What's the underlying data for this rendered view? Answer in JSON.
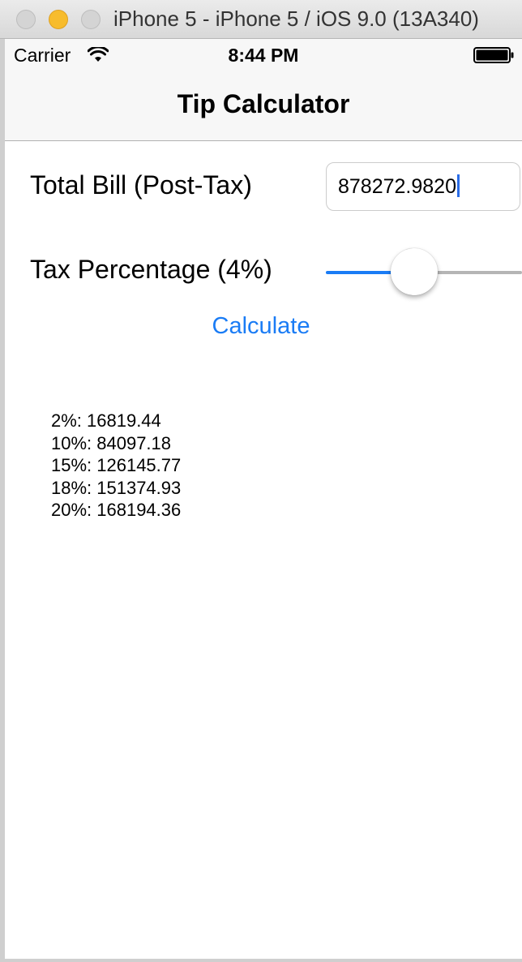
{
  "window": {
    "title": "iPhone 5 - iPhone 5 / iOS 9.0 (13A340)"
  },
  "status_bar": {
    "carrier": "Carrier",
    "time": "8:44 PM",
    "wifi_icon": "wifi-icon",
    "battery_icon": "battery-icon"
  },
  "nav": {
    "title": "Tip Calculator"
  },
  "form": {
    "bill_label": "Total Bill (Post-Tax)",
    "bill_value": "878272.9820",
    "tax_label": "Tax Percentage (4%)",
    "tax_slider_fraction": 0.45,
    "calculate_label": "Calculate"
  },
  "results": [
    "2%: 16819.44",
    "10%: 84097.18",
    "15%: 126145.77",
    "18%: 151374.93",
    "20%: 168194.36"
  ],
  "colors": {
    "accent": "#1a7cf5",
    "minimize": "#f7bc2d"
  }
}
